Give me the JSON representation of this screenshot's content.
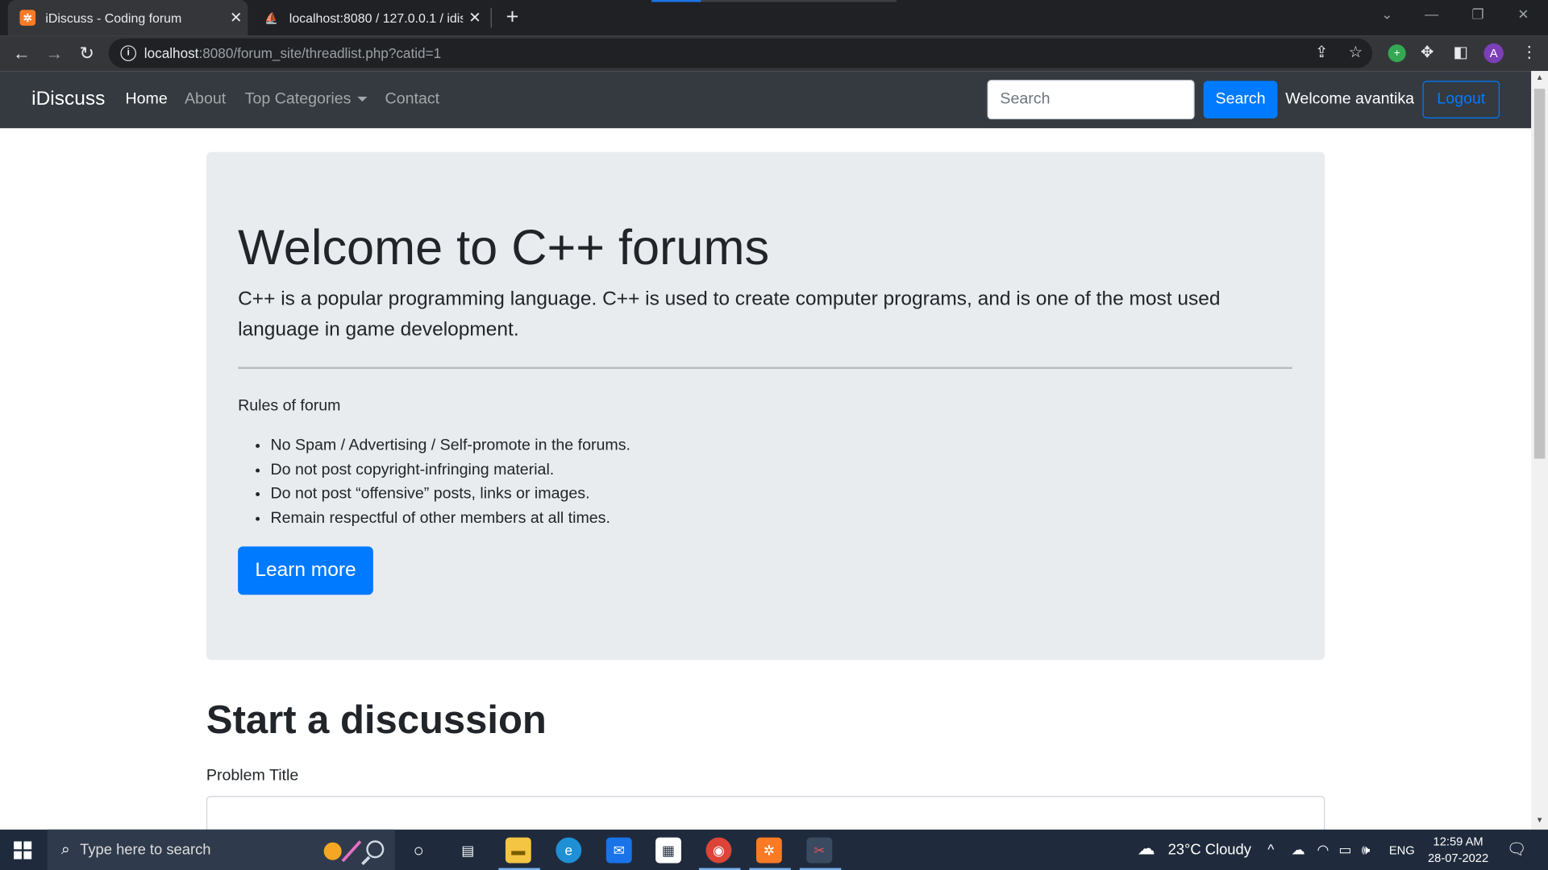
{
  "browser": {
    "tabs": [
      {
        "title": "iDiscuss - Coding forum",
        "active": true
      },
      {
        "title": "localhost:8080 / 127.0.0.1 / idiscu",
        "active": false
      }
    ],
    "url_host": "localhost",
    "url_path": ":8080/forum_site/threadlist.php?catid=1",
    "profile_initial": "A"
  },
  "navbar": {
    "brand": "iDiscuss",
    "links": [
      "Home",
      "About",
      "Top Categories",
      "Contact"
    ],
    "search_placeholder": "Search",
    "search_button": "Search",
    "welcome": "Welcome avantika",
    "logout": "Logout"
  },
  "jumbotron": {
    "title": "Welcome to C++ forums",
    "lead": "C++ is a popular programming language. C++ is used to create computer programs, and is one of the most used language in game development.",
    "rules_heading": "Rules of forum",
    "rules": [
      "No Spam / Advertising / Self-promote in the forums.",
      "Do not post copyright-infringing material.",
      "Do not post “offensive” posts, links or images.",
      "Remain respectful of other members at all times."
    ],
    "button": "Learn more"
  },
  "form": {
    "heading": "Start a discussion",
    "problem_title_label": "Problem Title"
  },
  "taskbar": {
    "search_placeholder": "Type here to search",
    "weather": "23°C  Cloudy",
    "language": "ENG",
    "time": "12:59 AM",
    "date": "28-07-2022"
  },
  "colors": {
    "primary": "#007bff",
    "navbar_bg": "#343a40",
    "jumbotron_bg": "#e9ecef"
  }
}
